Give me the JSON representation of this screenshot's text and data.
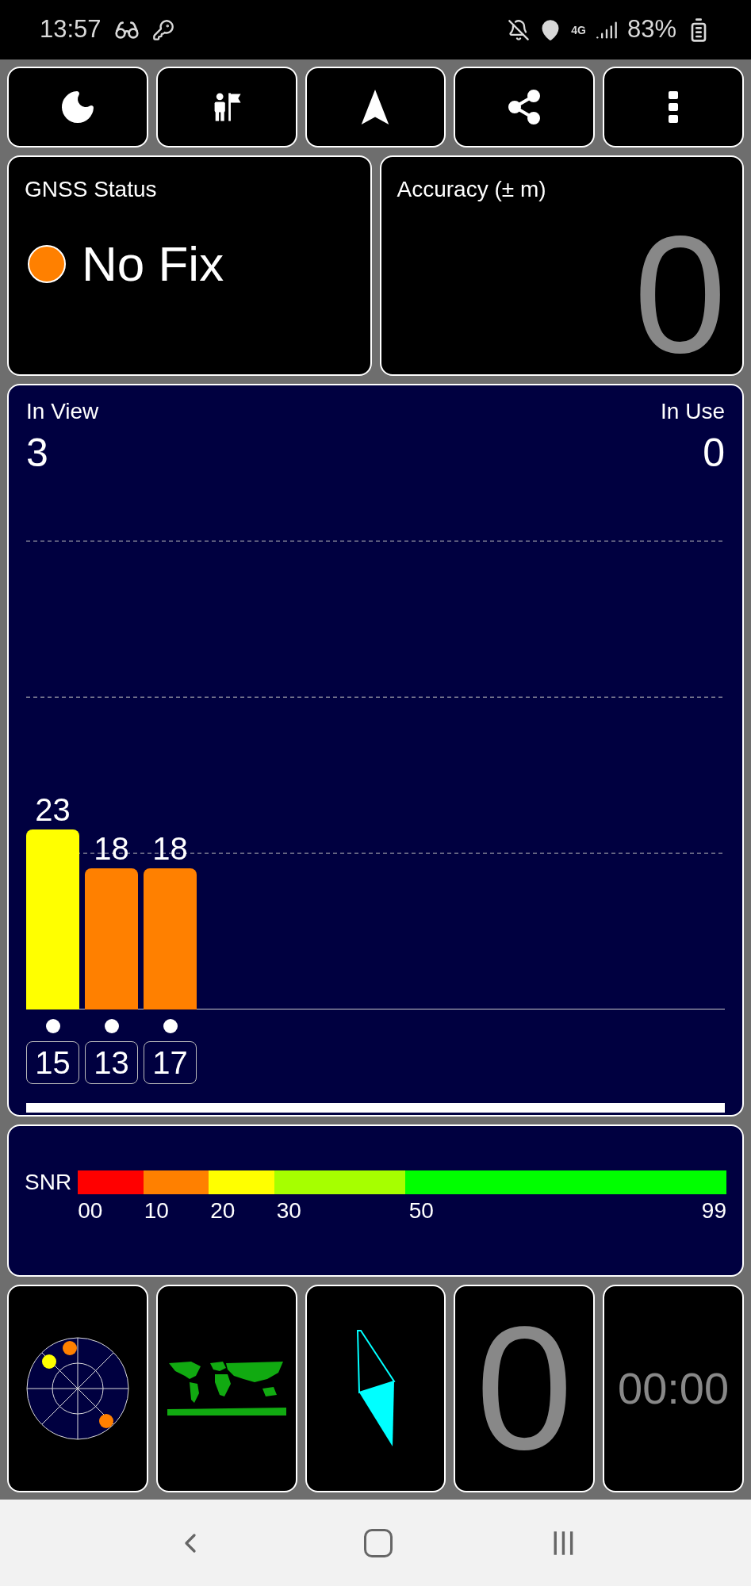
{
  "status_bar": {
    "time": "13:57",
    "network": "4G",
    "battery": "83%"
  },
  "toolbar": {
    "buttons": [
      {
        "kind": "night"
      },
      {
        "kind": "guide"
      },
      {
        "kind": "navigate"
      },
      {
        "kind": "share"
      },
      {
        "kind": "menu"
      }
    ]
  },
  "gnss_status": {
    "label": "GNSS Status",
    "value": "No Fix",
    "color": "#ff8000"
  },
  "accuracy": {
    "label": "Accuracy (± m)",
    "value": "0"
  },
  "satellites": {
    "in_view_label": "In View",
    "in_view": "3",
    "in_use_label": "In Use",
    "in_use": "0",
    "chart_data": {
      "type": "bar",
      "categories": [
        "15",
        "13",
        "17"
      ],
      "series": [
        {
          "values": [
            23,
            18,
            18
          ]
        }
      ],
      "data_labels": true
    }
  },
  "snr_legend": {
    "label": "SNR",
    "segments": [
      {
        "tick": "00",
        "color": "#ff0000"
      },
      {
        "tick": "10",
        "color": "#ff8000"
      },
      {
        "tick": "20",
        "color": "#ffff00"
      },
      {
        "tick": "30",
        "color": "#a6ff00"
      },
      {
        "tick": "50",
        "color": "#00ff00"
      }
    ],
    "end_tick": "99"
  },
  "tiles": {
    "speed": "0",
    "timer": "00:00"
  }
}
